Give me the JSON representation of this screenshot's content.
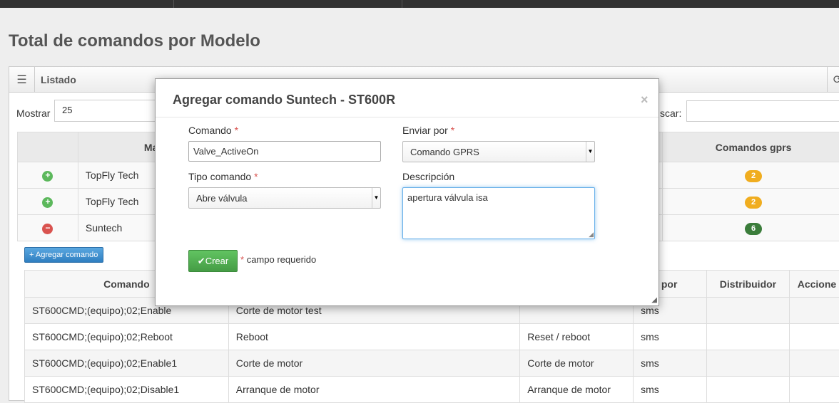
{
  "page_title": "Total de comandos por Modelo",
  "panel": {
    "title": "Listado"
  },
  "controls": {
    "show_label": "Mostrar",
    "show_value": "25",
    "search_label": "scar:"
  },
  "main_table": {
    "headers": [
      "",
      "Ma",
      "Comandos gprs"
    ],
    "rows": [
      {
        "icon": "plus-circle-icon",
        "icon_color": "#5cb85c",
        "brand": "TopFly Tech",
        "gprs": "2",
        "badge_color": "#f0ad1f"
      },
      {
        "icon": "plus-circle-icon",
        "icon_color": "#5cb85c",
        "brand": "TopFly Tech",
        "gprs": "2",
        "badge_color": "#f0ad1f"
      },
      {
        "icon": "minus-circle-icon",
        "icon_color": "#d9534f",
        "brand": "Suntech",
        "gprs": "6",
        "badge_color": "#3b7d3b"
      }
    ]
  },
  "add_command_btn": "+ Agregar comando",
  "sub_table": {
    "headers": [
      "Comando",
      "",
      "",
      "viar por",
      "Distribuidor",
      "Accione"
    ],
    "rows": [
      [
        "ST600CMD;(equipo);02;Enable",
        "Corte de motor test",
        "",
        "sms",
        "",
        ""
      ],
      [
        "ST600CMD;(equipo);02;Reboot",
        "Reboot",
        "Reset / reboot",
        "sms",
        "",
        ""
      ],
      [
        "ST600CMD;(equipo);02;Enable1",
        "Corte de motor",
        "Corte de motor",
        "sms",
        "",
        ""
      ],
      [
        "ST600CMD;(equipo);02;Disable1",
        "Arranque de motor",
        "Arranque de motor",
        "sms",
        "",
        ""
      ]
    ]
  },
  "modal": {
    "title": "Agregar comando Suntech - ST600R",
    "close": "×",
    "comando_label": "Comando",
    "comando_value": "Valve_ActiveOn",
    "enviar_label": "Enviar por",
    "enviar_value": "Comando GPRS",
    "tipo_label": "Tipo comando",
    "tipo_value": "Abre válvula",
    "desc_label": "Descripción",
    "desc_value": "apertura válvula isa",
    "crear_label": "Crear",
    "required_mark": "*",
    "required_note": "campo requerido"
  },
  "colors": {
    "accent_blue": "#2f7fc1",
    "success_green": "#459c45",
    "danger_red": "#d9534f"
  }
}
